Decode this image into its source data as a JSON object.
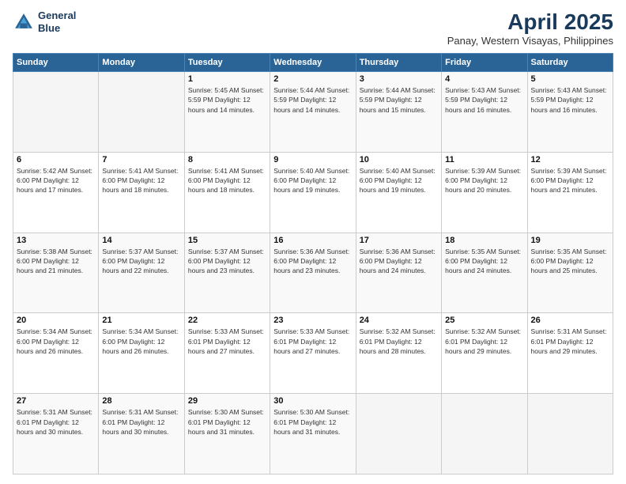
{
  "header": {
    "logo_line1": "General",
    "logo_line2": "Blue",
    "title": "April 2025",
    "subtitle": "Panay, Western Visayas, Philippines"
  },
  "columns": [
    "Sunday",
    "Monday",
    "Tuesday",
    "Wednesday",
    "Thursday",
    "Friday",
    "Saturday"
  ],
  "weeks": [
    [
      {
        "day": "",
        "info": ""
      },
      {
        "day": "",
        "info": ""
      },
      {
        "day": "1",
        "info": "Sunrise: 5:45 AM\nSunset: 5:59 PM\nDaylight: 12 hours\nand 14 minutes."
      },
      {
        "day": "2",
        "info": "Sunrise: 5:44 AM\nSunset: 5:59 PM\nDaylight: 12 hours\nand 14 minutes."
      },
      {
        "day": "3",
        "info": "Sunrise: 5:44 AM\nSunset: 5:59 PM\nDaylight: 12 hours\nand 15 minutes."
      },
      {
        "day": "4",
        "info": "Sunrise: 5:43 AM\nSunset: 5:59 PM\nDaylight: 12 hours\nand 16 minutes."
      },
      {
        "day": "5",
        "info": "Sunrise: 5:43 AM\nSunset: 5:59 PM\nDaylight: 12 hours\nand 16 minutes."
      }
    ],
    [
      {
        "day": "6",
        "info": "Sunrise: 5:42 AM\nSunset: 6:00 PM\nDaylight: 12 hours\nand 17 minutes."
      },
      {
        "day": "7",
        "info": "Sunrise: 5:41 AM\nSunset: 6:00 PM\nDaylight: 12 hours\nand 18 minutes."
      },
      {
        "day": "8",
        "info": "Sunrise: 5:41 AM\nSunset: 6:00 PM\nDaylight: 12 hours\nand 18 minutes."
      },
      {
        "day": "9",
        "info": "Sunrise: 5:40 AM\nSunset: 6:00 PM\nDaylight: 12 hours\nand 19 minutes."
      },
      {
        "day": "10",
        "info": "Sunrise: 5:40 AM\nSunset: 6:00 PM\nDaylight: 12 hours\nand 19 minutes."
      },
      {
        "day": "11",
        "info": "Sunrise: 5:39 AM\nSunset: 6:00 PM\nDaylight: 12 hours\nand 20 minutes."
      },
      {
        "day": "12",
        "info": "Sunrise: 5:39 AM\nSunset: 6:00 PM\nDaylight: 12 hours\nand 21 minutes."
      }
    ],
    [
      {
        "day": "13",
        "info": "Sunrise: 5:38 AM\nSunset: 6:00 PM\nDaylight: 12 hours\nand 21 minutes."
      },
      {
        "day": "14",
        "info": "Sunrise: 5:37 AM\nSunset: 6:00 PM\nDaylight: 12 hours\nand 22 minutes."
      },
      {
        "day": "15",
        "info": "Sunrise: 5:37 AM\nSunset: 6:00 PM\nDaylight: 12 hours\nand 23 minutes."
      },
      {
        "day": "16",
        "info": "Sunrise: 5:36 AM\nSunset: 6:00 PM\nDaylight: 12 hours\nand 23 minutes."
      },
      {
        "day": "17",
        "info": "Sunrise: 5:36 AM\nSunset: 6:00 PM\nDaylight: 12 hours\nand 24 minutes."
      },
      {
        "day": "18",
        "info": "Sunrise: 5:35 AM\nSunset: 6:00 PM\nDaylight: 12 hours\nand 24 minutes."
      },
      {
        "day": "19",
        "info": "Sunrise: 5:35 AM\nSunset: 6:00 PM\nDaylight: 12 hours\nand 25 minutes."
      }
    ],
    [
      {
        "day": "20",
        "info": "Sunrise: 5:34 AM\nSunset: 6:00 PM\nDaylight: 12 hours\nand 26 minutes."
      },
      {
        "day": "21",
        "info": "Sunrise: 5:34 AM\nSunset: 6:00 PM\nDaylight: 12 hours\nand 26 minutes."
      },
      {
        "day": "22",
        "info": "Sunrise: 5:33 AM\nSunset: 6:01 PM\nDaylight: 12 hours\nand 27 minutes."
      },
      {
        "day": "23",
        "info": "Sunrise: 5:33 AM\nSunset: 6:01 PM\nDaylight: 12 hours\nand 27 minutes."
      },
      {
        "day": "24",
        "info": "Sunrise: 5:32 AM\nSunset: 6:01 PM\nDaylight: 12 hours\nand 28 minutes."
      },
      {
        "day": "25",
        "info": "Sunrise: 5:32 AM\nSunset: 6:01 PM\nDaylight: 12 hours\nand 29 minutes."
      },
      {
        "day": "26",
        "info": "Sunrise: 5:31 AM\nSunset: 6:01 PM\nDaylight: 12 hours\nand 29 minutes."
      }
    ],
    [
      {
        "day": "27",
        "info": "Sunrise: 5:31 AM\nSunset: 6:01 PM\nDaylight: 12 hours\nand 30 minutes."
      },
      {
        "day": "28",
        "info": "Sunrise: 5:31 AM\nSunset: 6:01 PM\nDaylight: 12 hours\nand 30 minutes."
      },
      {
        "day": "29",
        "info": "Sunrise: 5:30 AM\nSunset: 6:01 PM\nDaylight: 12 hours\nand 31 minutes."
      },
      {
        "day": "30",
        "info": "Sunrise: 5:30 AM\nSunset: 6:01 PM\nDaylight: 12 hours\nand 31 minutes."
      },
      {
        "day": "",
        "info": ""
      },
      {
        "day": "",
        "info": ""
      },
      {
        "day": "",
        "info": ""
      }
    ]
  ]
}
